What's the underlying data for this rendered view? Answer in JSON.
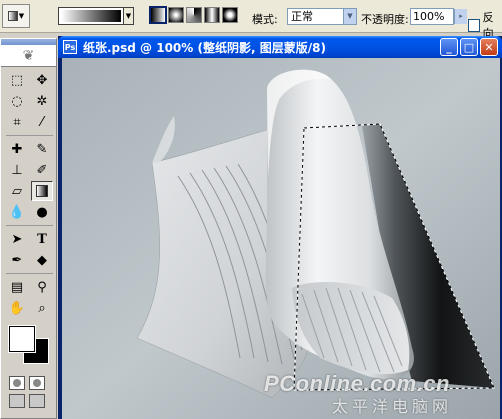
{
  "options_bar": {
    "mode_label": "模式:",
    "mode_value": "正常",
    "opacity_label": "不透明度:",
    "opacity_value": "100%",
    "reverse_label": "反向"
  },
  "document": {
    "title": "纸张.psd @ 100% (整纸阴影, 图层蒙版/8)",
    "icon": "Ps"
  },
  "watermark": {
    "line1": "PConline.com.cn",
    "line2": "太平洋电脑网"
  },
  "icons": {
    "options": [
      "gradient-tool-preset-icon",
      "gradient-picker",
      "linear-gradient-icon",
      "radial-gradient-icon",
      "angle-gradient-icon",
      "reflected-gradient-icon",
      "diamond-gradient-icon"
    ],
    "tools": [
      "marquee-icon",
      "move-icon",
      "lasso-icon",
      "magic-wand-icon",
      "crop-icon",
      "slice-icon",
      "healing-brush-icon",
      "brush-icon",
      "clone-stamp-icon",
      "history-brush-icon",
      "eraser-icon",
      "gradient-icon",
      "blur-icon",
      "dodge-icon",
      "path-select-icon",
      "type-icon",
      "pen-icon",
      "shape-icon",
      "notes-icon",
      "eyedropper-icon",
      "hand-icon",
      "zoom-icon"
    ]
  },
  "colors": {
    "foreground": "#ffffff",
    "background": "#000000",
    "titlebar": "#0052e4",
    "canvas": "#b8c2c8"
  },
  "selected_tool": "gradient-icon"
}
